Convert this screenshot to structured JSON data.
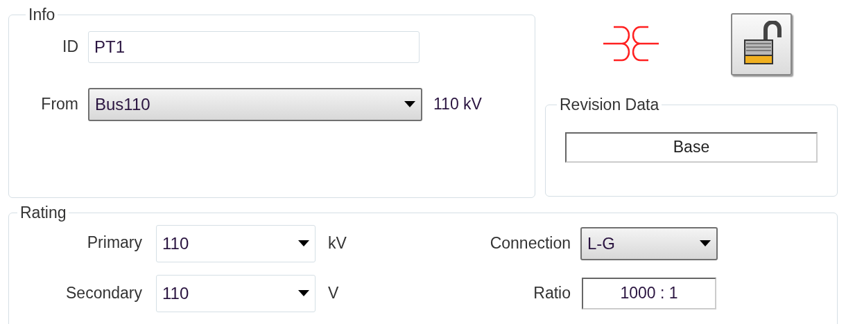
{
  "info": {
    "title": "Info",
    "id": {
      "label": "ID",
      "value": "PT1"
    },
    "from": {
      "label": "From",
      "value": "Bus110",
      "unit": "110 kV"
    }
  },
  "toolbar": {
    "lock": {
      "locked": false
    }
  },
  "revision": {
    "title": "Revision Data",
    "value": "Base"
  },
  "rating": {
    "title": "Rating",
    "primary": {
      "label": "Primary",
      "value": "110",
      "unit": "kV"
    },
    "secondary": {
      "label": "Secondary",
      "value": "110",
      "unit": "V"
    },
    "connection": {
      "label": "Connection",
      "value": "L-G"
    },
    "ratio": {
      "label": "Ratio",
      "value": "1000 : 1"
    }
  }
}
